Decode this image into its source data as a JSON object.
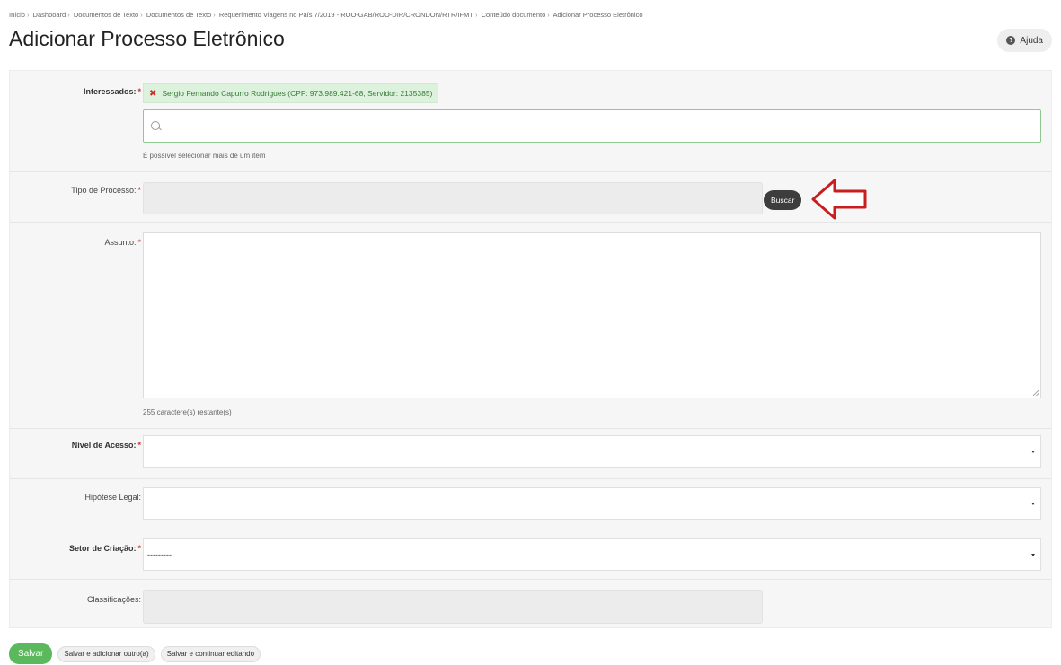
{
  "breadcrumb": [
    "Início",
    "Dashboard",
    "Documentos de Texto",
    "Documentos de Texto",
    "Requerimento Viagens no País 7/2019 - ROO-GAB/ROO-DIR/CRONDON/RTR/IFMT",
    "Conteúdo documento",
    "Adicionar Processo Eletrônico"
  ],
  "breadcrumb_separator": "›",
  "page_title": "Adicionar Processo Eletrônico",
  "help_label": "Ajuda",
  "help_icon_glyph": "?",
  "form": {
    "interessados": {
      "label": "Interessados:",
      "required_mark": "*",
      "selected_chip": "Sergio Fernando Capurro Rodrigues (CPF: 973.989.421-68, Servidor: 2135385)",
      "chip_remove_glyph": "✖",
      "search_value": "",
      "hint": "É possível selecionar mais de um item"
    },
    "tipo_processo": {
      "label": "Tipo de Processo:",
      "required_mark": "*",
      "value": "",
      "button_label": "Buscar"
    },
    "assunto": {
      "label": "Assunto:",
      "required_mark": "*",
      "value": "",
      "hint": "255 caractere(s) restante(s)"
    },
    "nivel_acesso": {
      "label": "Nível de Acesso:",
      "required_mark": "*",
      "value": ""
    },
    "hipotese_legal": {
      "label": "Hipótese Legal:",
      "value": ""
    },
    "setor_criacao": {
      "label": "Setor de Criação:",
      "required_mark": "*",
      "value": "---------"
    },
    "classificacoes": {
      "label": "Classificações:",
      "value": ""
    }
  },
  "footer": {
    "save_label": "Salvar",
    "save_add_label": "Salvar e adicionar outro(a)",
    "save_continue_label": "Salvar e continuar editando"
  },
  "colors": {
    "save_button": "#5cb85c",
    "required_mark": "#c9302c",
    "annotation_arrow": "#c81e1e"
  },
  "icons": [
    "help-icon",
    "remove-icon",
    "search-icon",
    "chevron-down-icon",
    "arrow-left-icon"
  ]
}
